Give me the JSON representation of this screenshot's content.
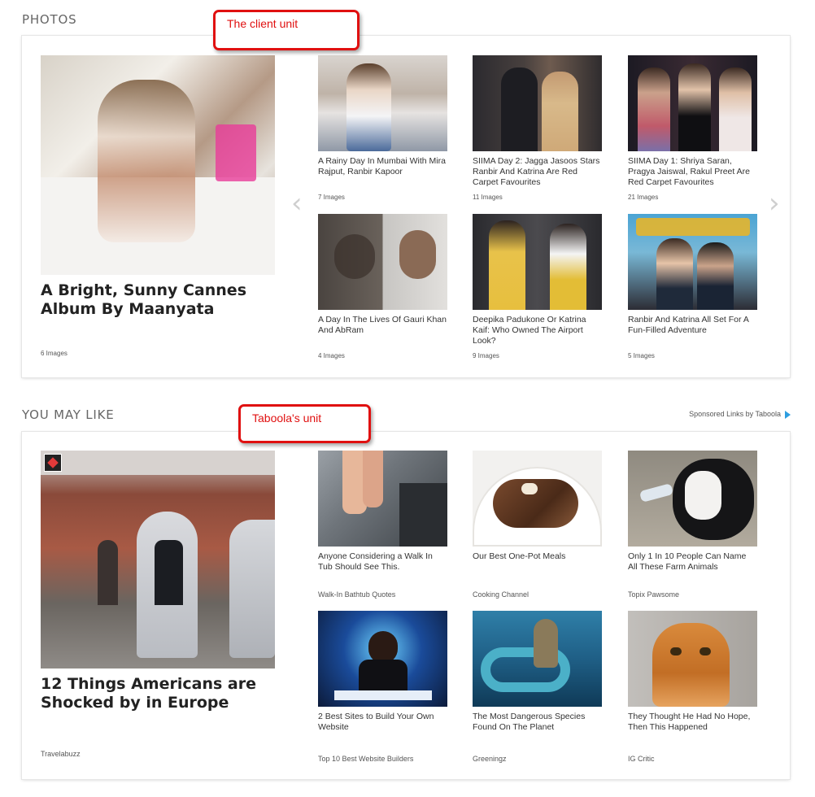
{
  "photos": {
    "title": "PHOTOS",
    "callout": "The client unit",
    "feature": {
      "title": "A Bright, Sunny Cannes Album By Maanyata",
      "meta": "6 Images"
    },
    "cards": [
      {
        "caption": "A Rainy Day In Mumbai With Mira Rajput, Ranbir Kapoor",
        "meta": "7 Images"
      },
      {
        "caption": "SIIMA Day 2: Jagga Jasoos Stars Ranbir And Katrina Are Red Carpet Favourites",
        "meta": "11 Images"
      },
      {
        "caption": "SIIMA Day 1: Shriya Saran, Pragya Jaiswal, Rakul Preet Are Red Carpet Favourites",
        "meta": "21 Images"
      },
      {
        "caption": "A Day In The Lives Of Gauri Khan And AbRam",
        "meta": "4 Images"
      },
      {
        "caption": "Deepika Padukone Or Katrina Kaif: Who Owned The Airport Look?",
        "meta": "9 Images"
      },
      {
        "caption": "Ranbir And Katrina All Set For A Fun-Filled Adventure",
        "meta": "5 Images"
      }
    ],
    "icons": {
      "prev": "chevron-left-icon",
      "next": "chevron-right-icon"
    }
  },
  "you_may_like": {
    "title": "YOU MAY LIKE",
    "callout": "Taboola's unit",
    "sponsored": "Sponsored Links by Taboola",
    "feature": {
      "title": "12 Things Americans are Shocked by in Europe",
      "source": "Travelabuzz"
    },
    "cards": [
      {
        "caption": "Anyone Considering a Walk In Tub Should See This.",
        "source": "Walk-In Bathtub Quotes"
      },
      {
        "caption": "Our Best One-Pot Meals",
        "source": "Cooking Channel"
      },
      {
        "caption": "Only 1 In 10 People Can Name All These Farm Animals",
        "source": "Topix Pawsome"
      },
      {
        "caption": "2 Best Sites to Build Your Own Website",
        "source": "Top 10 Best Website Builders"
      },
      {
        "caption": "The Most Dangerous Species Found On The Planet",
        "source": "Greeningz"
      },
      {
        "caption": "They Thought He Had No Hope, Then This Happened",
        "source": "IG Critic"
      }
    ]
  },
  "colors": {
    "callout_red": "#e01010",
    "taboola_blue": "#2d9ee0"
  }
}
